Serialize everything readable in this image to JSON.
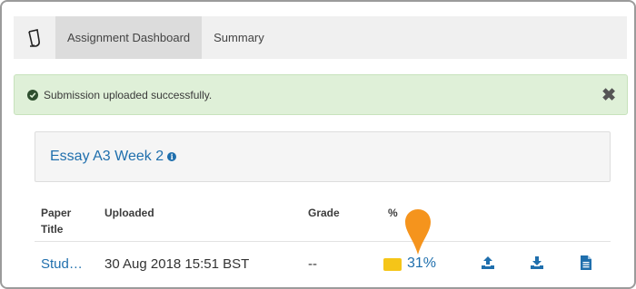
{
  "nav": {
    "tabs": [
      {
        "label": "Assignment Dashboard",
        "active": true
      },
      {
        "label": "Summary",
        "active": false
      }
    ]
  },
  "alert": {
    "message": "Submission uploaded successfully.",
    "close_label": "✖"
  },
  "assignment": {
    "title": "Essay A3 Week 2",
    "info_glyph": "i"
  },
  "table": {
    "headers": {
      "paper": "Paper",
      "title": "Title",
      "uploaded": "Uploaded",
      "grade": "Grade",
      "percent": "%"
    },
    "rows": [
      {
        "title": "Stud…",
        "uploaded": "30 Aug 2018 15:51 BST",
        "grade": "--",
        "similarity": "31%",
        "similarity_color": "#f5c518"
      }
    ]
  },
  "colors": {
    "link": "#1f6fad",
    "alert_bg": "#dff0d8",
    "pin": "#f5941d"
  },
  "icons": [
    "logo-icon",
    "check-circle-icon",
    "close-icon",
    "info-icon",
    "location-pin-icon",
    "upload-icon",
    "download-icon",
    "document-icon"
  ]
}
